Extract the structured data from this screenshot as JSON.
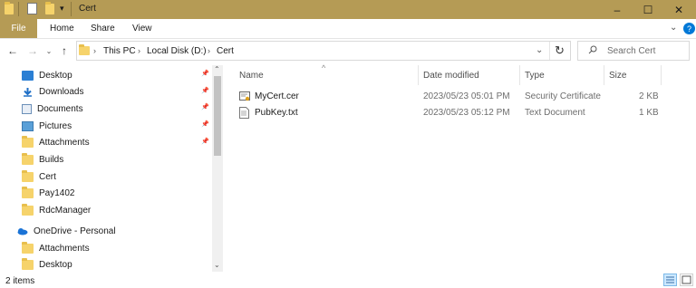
{
  "window": {
    "title": "Cert"
  },
  "ribbon": {
    "file": "File",
    "tabs": [
      "Home",
      "Share",
      "View"
    ]
  },
  "address": {
    "crumbs": [
      "This PC",
      "Local Disk (D:)",
      "Cert"
    ]
  },
  "search": {
    "placeholder": "Search Cert"
  },
  "nav": {
    "quick_access": [
      {
        "label": "Desktop",
        "icon": "desktop-icon",
        "pinned": true
      },
      {
        "label": "Downloads",
        "icon": "download-icon",
        "pinned": true
      },
      {
        "label": "Documents",
        "icon": "documents-icon",
        "pinned": true
      },
      {
        "label": "Pictures",
        "icon": "pictures-icon",
        "pinned": true
      },
      {
        "label": "Attachments",
        "icon": "folder-icon",
        "pinned": true
      },
      {
        "label": "Builds",
        "icon": "folder-icon",
        "pinned": false
      },
      {
        "label": "Cert",
        "icon": "folder-icon",
        "pinned": false
      },
      {
        "label": "Pay1402",
        "icon": "folder-icon",
        "pinned": false
      },
      {
        "label": "RdcManager",
        "icon": "folder-icon",
        "pinned": false
      }
    ],
    "onedrive": {
      "label": "OneDrive - Personal",
      "icon": "onedrive-icon"
    },
    "onedrive_items": [
      {
        "label": "Attachments",
        "icon": "folder-icon"
      },
      {
        "label": "Desktop",
        "icon": "folder-icon"
      }
    ]
  },
  "columns": {
    "name": "Name",
    "date": "Date modified",
    "type": "Type",
    "size": "Size"
  },
  "files": [
    {
      "name": "MyCert.cer",
      "date": "2023/05/23 05:01 PM",
      "type": "Security Certificate",
      "size": "2 KB",
      "icon": "certificate-icon"
    },
    {
      "name": "PubKey.txt",
      "date": "2023/05/23 05:12 PM",
      "type": "Text Document",
      "size": "1 KB",
      "icon": "text-file-icon"
    }
  ],
  "status": {
    "count": "2 items"
  },
  "colors": {
    "titlebar": "#b59b55",
    "folder": "#f6d36b",
    "accent": "#0078d7"
  }
}
